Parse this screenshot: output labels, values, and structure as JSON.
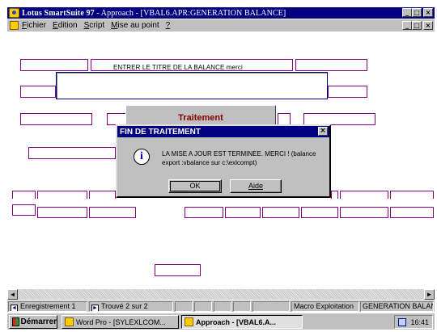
{
  "window": {
    "title_app": "Lotus SmartSuite 97",
    "title_sep": " - ",
    "title_doc": "Approach - [VBAL6.APR:GENERATION BALANCE]",
    "minimize": "_",
    "maximize": "□",
    "close": "×"
  },
  "menu": {
    "items": [
      {
        "label": "Fichier",
        "accel": "F"
      },
      {
        "label": "Edition",
        "accel": "E"
      },
      {
        "label": "Script",
        "accel": "S"
      },
      {
        "label": "Mise au point",
        "accel": "M"
      },
      {
        "label": "?",
        "accel": "?"
      }
    ]
  },
  "form": {
    "title_label": "ENTRER LE TITRE DE LA BALANCE  merci",
    "title_value": "",
    "traitement_label": "Traitement"
  },
  "dialog": {
    "title": "FIN DE TRAITEMENT",
    "close": "×",
    "icon": "info-icon",
    "message": "LA MISE A JOUR EST TERMINEE. MERCI ! (balance export :vbalance sur c:\\exlcompt)",
    "ok_label": "OK",
    "aide_label": "Aide"
  },
  "statusbar": {
    "record": "Enregistrement 1",
    "found": "Trouvé 2 sur 2",
    "macro": "Macro Exploitation",
    "view": "GENERATION BALANCE"
  },
  "taskbar": {
    "start": "Démarrer",
    "task1": "Word Pro - [SYLEXLCOM...",
    "task2": "Approach - [VBAL6.A...",
    "clock": "16:41"
  },
  "colors": {
    "titlebar": "#000080",
    "field_border": "#800080",
    "traitement_text": "#800000",
    "chrome": "#c0c0c0"
  }
}
